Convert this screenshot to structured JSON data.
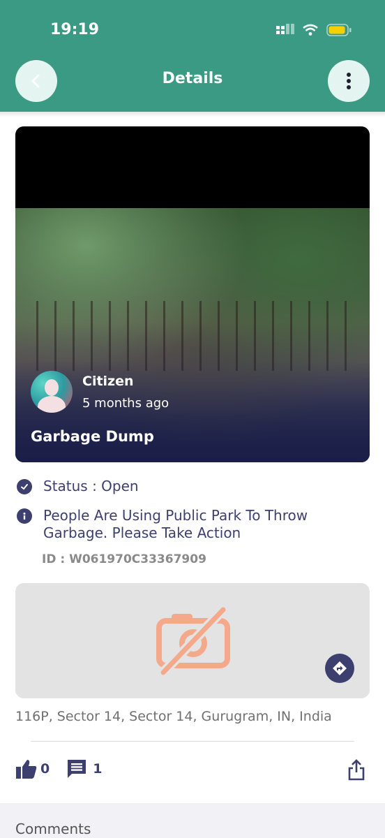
{
  "status_bar": {
    "time": "19:19"
  },
  "header": {
    "title": "Details"
  },
  "post": {
    "author": "Citizen",
    "posted": "5 months ago",
    "title": "Garbage Dump",
    "status": "Status : Open",
    "description": "People Are Using Public Park To Throw Garbage. Please Take Action",
    "id": "ID : W061970C33367909",
    "address": "116P, Sector 14, Sector 14, Gurugram, IN, India"
  },
  "actions": {
    "likes": "0",
    "comments": "1"
  },
  "comments": {
    "label": "Comments"
  },
  "colors": {
    "brand": "#3a9a83",
    "accent": "#3d3f6e",
    "placeholder": "#f5a98b"
  },
  "icons": [
    "back-arrow-icon",
    "more-vert-icon",
    "check-circle-icon",
    "info-icon",
    "no-image-icon",
    "directions-icon",
    "thumb-up-icon",
    "comment-icon",
    "share-icon"
  ]
}
